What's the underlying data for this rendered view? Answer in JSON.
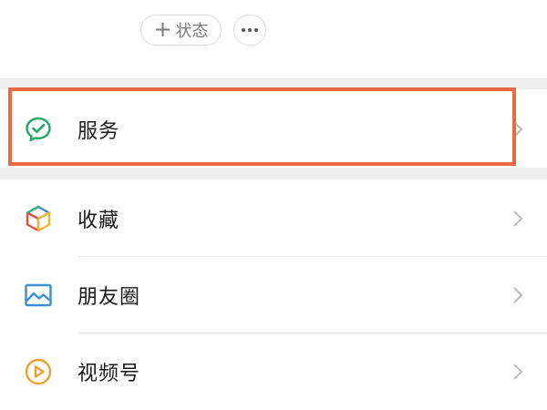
{
  "header": {
    "status_button_label": "状态",
    "status_button_icon": "plus-icon",
    "more_button_icon": "more-icon"
  },
  "menu": {
    "items": [
      {
        "label": "服务",
        "icon": "service-icon",
        "highlighted": true
      },
      {
        "label": "收藏",
        "icon": "favorites-icon"
      },
      {
        "label": "朋友圈",
        "icon": "moments-icon"
      },
      {
        "label": "视频号",
        "icon": "channels-icon"
      }
    ]
  },
  "colors": {
    "highlight_border": "#ea6b43",
    "service_green": "#21a866",
    "moments_blue": "#3d8fd1",
    "channels_orange": "#f0a030",
    "section_gap": "#ededed"
  }
}
